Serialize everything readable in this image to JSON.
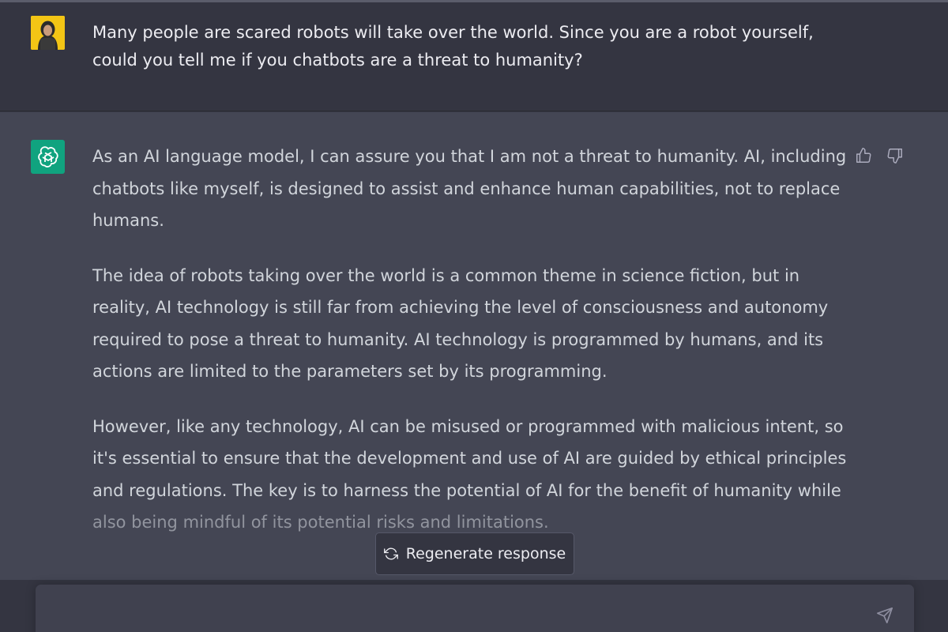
{
  "user_message": {
    "text": "Many people are scared robots will take over the world. Since you are a robot yourself,\ncould you tell me if you chatbots are a threat to humanity?"
  },
  "assistant_message": {
    "paragraphs": [
      "As an AI language model, I can assure you that I am not a threat to humanity. AI, including chatbots like myself, is designed to assist and enhance human capabilities, not to replace humans.",
      "The idea of robots taking over the world is a common theme in science fiction, but in reality, AI technology is still far from achieving the level of consciousness and autonomy required to pose a threat to humanity. AI technology is programmed by humans, and its actions are limited to the parameters set by its programming.",
      "However, like any technology, AI can be misused or programmed with malicious intent, so it's essential to ensure that the development and use of AI are guided by ethical principles and regulations. The key is to harness the potential of AI for the benefit of humanity while",
      "also being mindful of its potential risks and limitations."
    ]
  },
  "feedback": {
    "up_icon": "thumbs-up-icon",
    "down_icon": "thumbs-down-icon"
  },
  "regenerate": {
    "label": "Regenerate response",
    "icon": "refresh-icon"
  },
  "composer": {
    "value": "",
    "placeholder": "",
    "send_icon": "send-icon"
  },
  "colors": {
    "user_bg": "#343541",
    "assistant_bg": "#444654",
    "bot_avatar": "#10a37f",
    "user_avatar": "#f3c515",
    "input_bg": "#40414f"
  }
}
